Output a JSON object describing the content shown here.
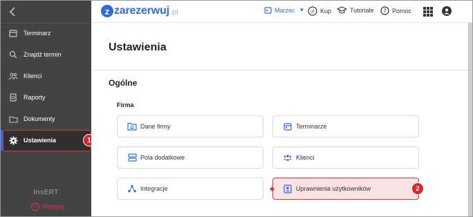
{
  "app": {
    "logo_word": "zarezerwuj",
    "logo_tld": ".pl",
    "logo_letter": "z"
  },
  "header": {
    "month_label": "Marzec",
    "buy_label": "Kup",
    "tutorials_label": "Tutoriale",
    "help_label": "Pomoc"
  },
  "sidebar": {
    "items": [
      {
        "label": "Terminarz",
        "icon": "calendar-icon"
      },
      {
        "label": "Znajdź termin",
        "icon": "search-icon"
      },
      {
        "label": "Klienci",
        "icon": "users-icon"
      },
      {
        "label": "Raporty",
        "icon": "report-icon"
      },
      {
        "label": "Dokumenty",
        "icon": "folder-icon"
      },
      {
        "label": "Ustawienia",
        "icon": "gear-icon",
        "active": true
      }
    ],
    "brand": "InsERT",
    "logout_label": "Wyloguj"
  },
  "main": {
    "page_title": "Ustawienia",
    "section_title": "Ogólne",
    "subsection_title": "Firma",
    "cards": [
      {
        "label": "Dane firmy",
        "icon": "company-data-icon"
      },
      {
        "label": "Terminarze",
        "icon": "calendar-icon"
      },
      {
        "label": "Pola dodatkowe",
        "icon": "fields-icon"
      },
      {
        "label": "Klienci",
        "icon": "users-icon"
      },
      {
        "label": "Integracje",
        "icon": "integration-icon"
      },
      {
        "label": "Uprawnienia użytkowników",
        "icon": "user-permissions-icon",
        "highlighted": true
      }
    ]
  },
  "annotations": {
    "step1": "1",
    "step2": "2"
  },
  "colors": {
    "accent": "#2f6bda",
    "highlight": "#e2323f",
    "sidebar_bg": "#434343"
  }
}
